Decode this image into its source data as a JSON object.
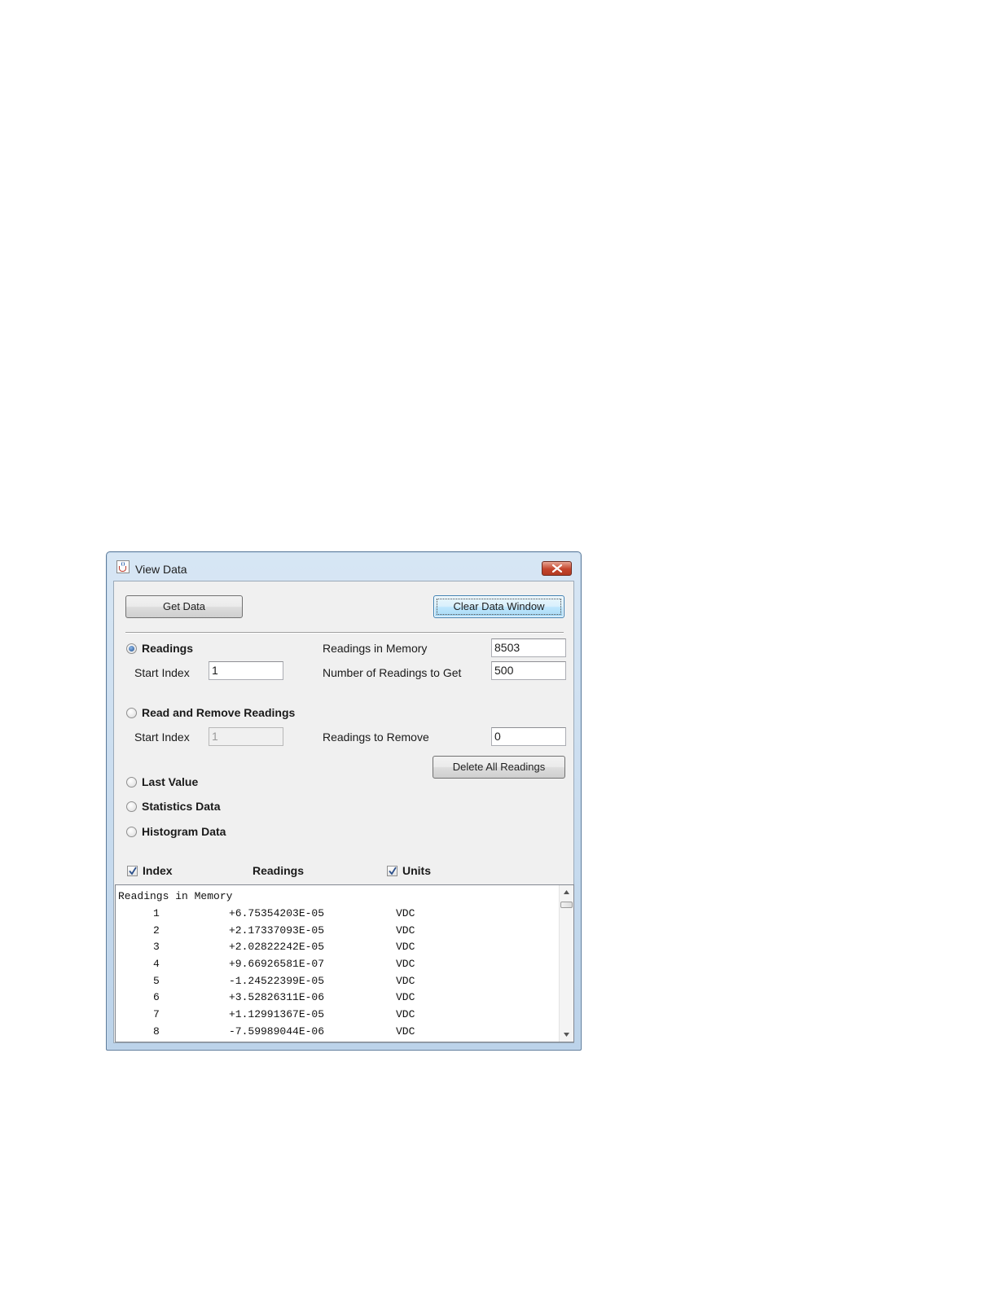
{
  "window": {
    "title": "View Data",
    "icon": "java-cup-icon",
    "close_icon": "close-icon"
  },
  "toolbar": {
    "get_data_label": "Get Data",
    "clear_data_window_label": "Clear Data Window"
  },
  "readings_section": {
    "label": "Readings",
    "selected": true,
    "start_index_label": "Start Index",
    "start_index_value": "1",
    "readings_in_memory_label": "Readings in Memory",
    "readings_in_memory_value": "8503",
    "number_to_get_label": "Number of Readings to Get",
    "number_to_get_value": "500"
  },
  "read_remove_section": {
    "label": "Read and Remove Readings",
    "selected": false,
    "start_index_label": "Start Index",
    "start_index_value": "1",
    "readings_to_remove_label": "Readings to Remove",
    "readings_to_remove_value": "0",
    "delete_all_label": "Delete All Readings"
  },
  "other_options": [
    {
      "label": "Last Value",
      "selected": false
    },
    {
      "label": "Statistics Data",
      "selected": false
    },
    {
      "label": "Histogram Data",
      "selected": false
    }
  ],
  "columns": {
    "index_label": "Index",
    "index_checked": true,
    "readings_label": "Readings",
    "units_label": "Units",
    "units_checked": true
  },
  "output": {
    "header": "Readings in Memory",
    "rows": [
      {
        "index": "1",
        "value": "+6.75354203E-05",
        "unit": "VDC"
      },
      {
        "index": "2",
        "value": "+2.17337093E-05",
        "unit": "VDC"
      },
      {
        "index": "3",
        "value": "+2.02822242E-05",
        "unit": "VDC"
      },
      {
        "index": "4",
        "value": "+9.66926581E-07",
        "unit": "VDC"
      },
      {
        "index": "5",
        "value": "-1.24522399E-05",
        "unit": "VDC"
      },
      {
        "index": "6",
        "value": "+3.52826311E-06",
        "unit": "VDC"
      },
      {
        "index": "7",
        "value": "+1.12991367E-05",
        "unit": "VDC"
      },
      {
        "index": "8",
        "value": "-7.59989044E-06",
        "unit": "VDC"
      }
    ]
  },
  "colors": {
    "titlebar_accent": "#bcd3ea",
    "dialog_background": "#f0f0f0",
    "close_button": "#c4452c",
    "radio_selected": "#1f4f8f"
  }
}
